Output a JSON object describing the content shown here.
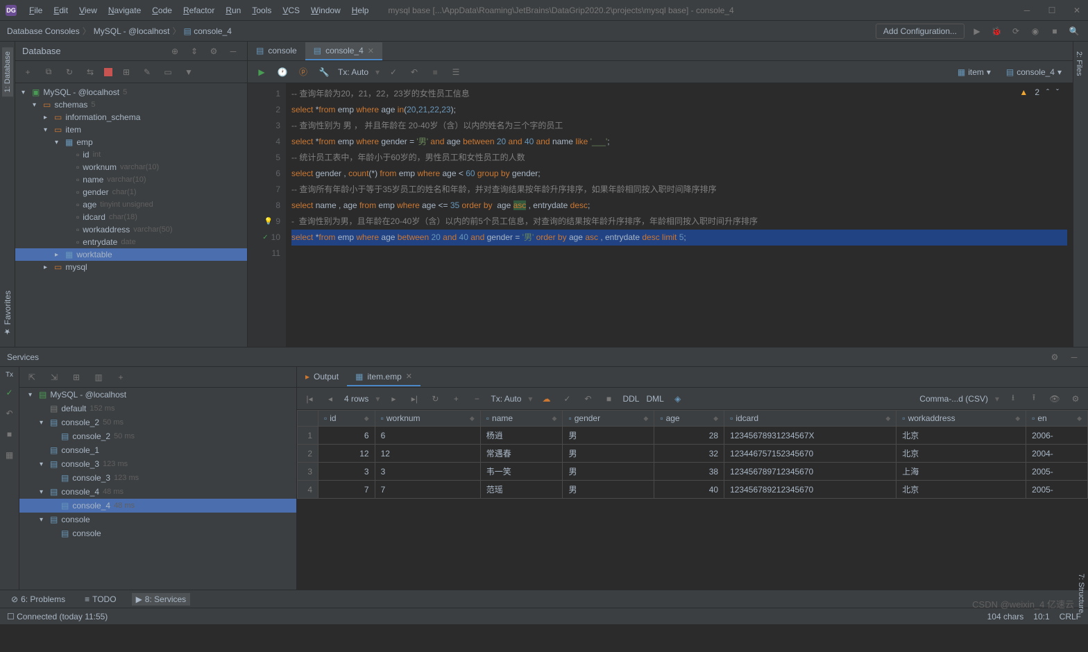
{
  "app": {
    "title": "mysql base [...\\AppData\\Roaming\\JetBrains\\DataGrip2020.2\\projects\\mysql base] - console_4"
  },
  "menubar": [
    "File",
    "Edit",
    "View",
    "Navigate",
    "Code",
    "Refactor",
    "Run",
    "Tools",
    "VCS",
    "Window",
    "Help"
  ],
  "breadcrumb": [
    "Database Consoles",
    "MySQL - @localhost",
    "console_4"
  ],
  "add_config": "Add Configuration...",
  "db_panel": {
    "title": "Database",
    "root": "MySQL - @localhost",
    "root_count": "5",
    "schemas": "schemas",
    "schemas_count": "5",
    "info_schema": "information_schema",
    "item": "item",
    "emp": "emp",
    "cols": [
      {
        "n": "id",
        "t": "int"
      },
      {
        "n": "worknum",
        "t": "varchar(10)"
      },
      {
        "n": "name",
        "t": "varchar(10)"
      },
      {
        "n": "gender",
        "t": "char(1)"
      },
      {
        "n": "age",
        "t": "tinyint unsigned"
      },
      {
        "n": "idcard",
        "t": "char(18)"
      },
      {
        "n": "workaddress",
        "t": "varchar(50)"
      },
      {
        "n": "entrydate",
        "t": "date"
      }
    ],
    "worktable": "worktable",
    "mysql": "mysql"
  },
  "editor": {
    "tabs": [
      {
        "l": "console",
        "a": false
      },
      {
        "l": "console_4",
        "a": true
      }
    ],
    "tx": "Tx: Auto",
    "warn_count": "2",
    "status_item": "item",
    "status_console": "console_4",
    "lines": [
      {
        "n": "1",
        "t": "comment",
        "txt": "-- 查询年龄为20，21，22，23岁的女性员工信息"
      },
      {
        "n": "2",
        "t": "sql",
        "seg": [
          [
            "kw",
            "select "
          ],
          [
            "op",
            "*"
          ],
          [
            "kw",
            "from "
          ],
          [
            "op",
            "emp "
          ],
          [
            "kw",
            "where "
          ],
          [
            "op",
            "age "
          ],
          [
            "kw",
            "in"
          ],
          [
            "op",
            "("
          ],
          [
            "num",
            "20"
          ],
          [
            "op",
            ","
          ],
          [
            "num",
            "21"
          ],
          [
            "op",
            ","
          ],
          [
            "num",
            "22"
          ],
          [
            "op",
            ","
          ],
          [
            "num",
            "23"
          ],
          [
            "op",
            ");"
          ]
        ]
      },
      {
        "n": "3",
        "t": "comment",
        "txt": "-- 查询性别为 男 ， 并且年龄在 20-40岁（含）以内的姓名为三个字的员工"
      },
      {
        "n": "4",
        "t": "sql",
        "seg": [
          [
            "kw",
            "select "
          ],
          [
            "op",
            "*"
          ],
          [
            "kw",
            "from "
          ],
          [
            "op",
            "emp "
          ],
          [
            "kw",
            "where "
          ],
          [
            "op",
            "gender = "
          ],
          [
            "str",
            "'男'"
          ],
          [
            "kw",
            " and "
          ],
          [
            "op",
            "age "
          ],
          [
            "kw",
            "between "
          ],
          [
            "num",
            "20"
          ],
          [
            "kw",
            " and "
          ],
          [
            "num",
            "40"
          ],
          [
            "kw",
            " and "
          ],
          [
            "op",
            "name "
          ],
          [
            "kw",
            "like "
          ],
          [
            "str",
            "'___'"
          ],
          [
            "op",
            ";"
          ]
        ]
      },
      {
        "n": "5",
        "t": "comment",
        "txt": "-- 统计员工表中，年龄小于60岁的，男性员工和女性员工的人数"
      },
      {
        "n": "6",
        "t": "sql",
        "seg": [
          [
            "kw",
            "select "
          ],
          [
            "op",
            "gender , "
          ],
          [
            "kw",
            "count"
          ],
          [
            "op",
            "(*) "
          ],
          [
            "kw",
            "from "
          ],
          [
            "op",
            "emp "
          ],
          [
            "kw",
            "where "
          ],
          [
            "op",
            "age < "
          ],
          [
            "num",
            "60"
          ],
          [
            "kw",
            " group by "
          ],
          [
            "op",
            "gender;"
          ]
        ]
      },
      {
        "n": "7",
        "t": "comment",
        "txt": "-- 查询所有年龄小于等于35岁员工的姓名和年龄，并对查询结果按年龄升序排序，如果年龄相同按入职时间降序排序"
      },
      {
        "n": "8",
        "t": "sql",
        "seg": [
          [
            "kw",
            "select "
          ],
          [
            "op",
            "name , age "
          ],
          [
            "kw",
            "from "
          ],
          [
            "op",
            "emp "
          ],
          [
            "kw",
            "where "
          ],
          [
            "op",
            "age <= "
          ],
          [
            "num",
            "35"
          ],
          [
            "kw",
            " order by  "
          ],
          [
            "op",
            "age "
          ],
          [
            "hl",
            "asc"
          ],
          [
            "op",
            " , entrydate "
          ],
          [
            "kw",
            "desc"
          ],
          [
            "op",
            ";"
          ]
        ]
      },
      {
        "n": "9",
        "t": "comment",
        "txt": "-  查询性别为男，且年龄在20-40岁（含）以内的前5个员工信息，对查询的结果按年龄升序排序，年龄相同按入职时间升序排序",
        "bulb": true
      },
      {
        "n": "10",
        "t": "sql",
        "sel": true,
        "check": true,
        "seg": [
          [
            "kw",
            "select "
          ],
          [
            "op",
            "*"
          ],
          [
            "kw",
            "from "
          ],
          [
            "op",
            "emp "
          ],
          [
            "kw",
            "where "
          ],
          [
            "op",
            "age "
          ],
          [
            "kw",
            "between "
          ],
          [
            "num",
            "20"
          ],
          [
            "kw",
            " and "
          ],
          [
            "num",
            "40"
          ],
          [
            "kw",
            " and "
          ],
          [
            "op",
            "gender = "
          ],
          [
            "str",
            "'男'"
          ],
          [
            "kw",
            " order by "
          ],
          [
            "op",
            "age "
          ],
          [
            "kw",
            "asc"
          ],
          [
            "op",
            " , entrydate "
          ],
          [
            "kw",
            "desc limit "
          ],
          [
            "num",
            "5"
          ],
          [
            "op",
            ";"
          ]
        ]
      },
      {
        "n": "11",
        "t": "empty"
      }
    ]
  },
  "services": {
    "title": "Services",
    "rows_label": "4 rows",
    "tx": "Tx: Auto",
    "export": "Comma-...d (CSV)",
    "ddl": "DDL",
    "dml": "DML",
    "output_tab": "Output",
    "table_tab": "item.emp",
    "tree": {
      "root": "MySQL - @localhost",
      "default": "default",
      "default_t": "152 ms",
      "c2": "console_2",
      "c2_t": "50 ms",
      "c2i": "console_2",
      "c2i_t": "50 ms",
      "c1": "console_1",
      "c3": "console_3",
      "c3_t": "123 ms",
      "c3i": "console_3",
      "c3i_t": "123 ms",
      "c4": "console_4",
      "c4_t": "48 ms",
      "c4i": "console_4",
      "c4i_t": "48 ms",
      "c": "console",
      "ci": "console"
    },
    "columns": [
      "id",
      "worknum",
      "name",
      "gender",
      "age",
      "idcard",
      "workaddress",
      "en"
    ],
    "rows": [
      {
        "id": "6",
        "worknum": "6",
        "name": "杨逍",
        "gender": "男",
        "age": "28",
        "idcard": "12345678931234567X",
        "workaddress": "北京",
        "en": "2006-"
      },
      {
        "id": "12",
        "worknum": "12",
        "name": "常遇春",
        "gender": "男",
        "age": "32",
        "idcard": "123446757152345670",
        "workaddress": "北京",
        "en": "2004-"
      },
      {
        "id": "3",
        "worknum": "3",
        "name": "韦一笑",
        "gender": "男",
        "age": "38",
        "idcard": "123456789712345670",
        "workaddress": "上海",
        "en": "2005-"
      },
      {
        "id": "7",
        "worknum": "7",
        "name": "范瑶",
        "gender": "男",
        "age": "40",
        "idcard": "123456789212345670",
        "workaddress": "北京",
        "en": "2005-"
      }
    ]
  },
  "bottom": {
    "problems": "6: Problems",
    "todo": "TODO",
    "services": "8: Services"
  },
  "status": {
    "conn": "Connected (today 11:55)",
    "chars": "104 chars",
    "pos": "10:1",
    "crlf": "CRLF"
  },
  "left_tab": "1: Database",
  "right_tab1": "2: Files",
  "right_tab2": "7: Structure",
  "fav": "Favorites",
  "watermark": "CSDN @weixin_4        亿速云"
}
